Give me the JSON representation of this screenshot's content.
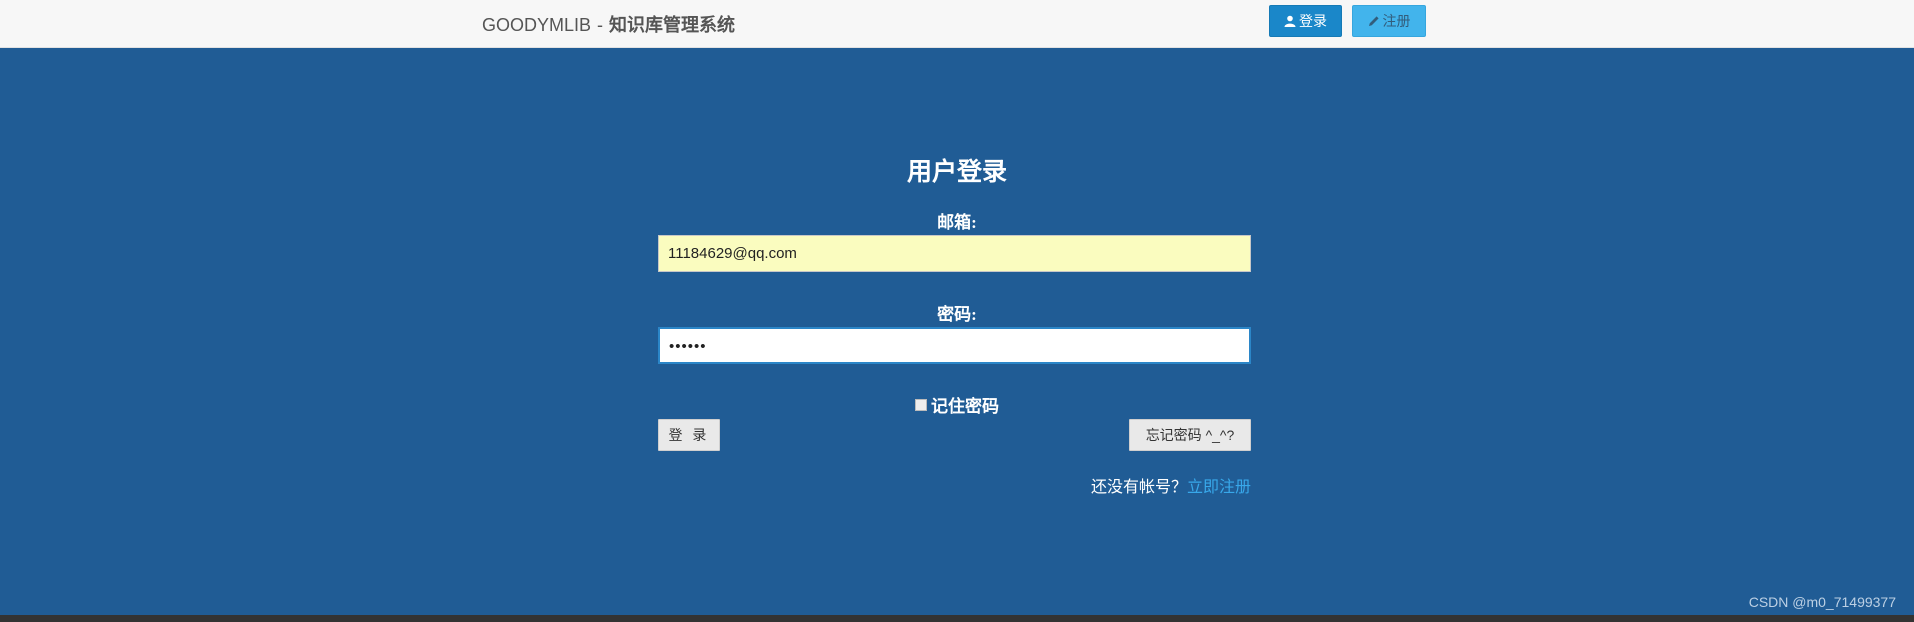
{
  "header": {
    "brand_en": "GOODYMLIB",
    "brand_sep": "-",
    "brand_cn": "知识库管理系统",
    "login_label": "登录",
    "register_label": "注册"
  },
  "login_form": {
    "title": "用户登录",
    "email_label": "邮箱:",
    "email_value": "11184629@qq.com",
    "password_label": "密码:",
    "password_masked": "••••••",
    "remember_label": "记住密码",
    "remember_checked": false,
    "submit_label": "登 录",
    "forgot_label": "忘记密码 ^_^?",
    "no_account_text": "还没有帐号？",
    "signup_link": "立即注册"
  },
  "watermark": "CSDN @m0_71499377",
  "colors": {
    "background": "#205c95",
    "topbar": "#f7f7f7",
    "login_button": "#1a87c9",
    "register_button": "#42b4ec",
    "email_field": "#fafcbf",
    "link": "#38a8ea"
  },
  "icons": {
    "login": "user-icon",
    "register": "pencil-icon"
  }
}
